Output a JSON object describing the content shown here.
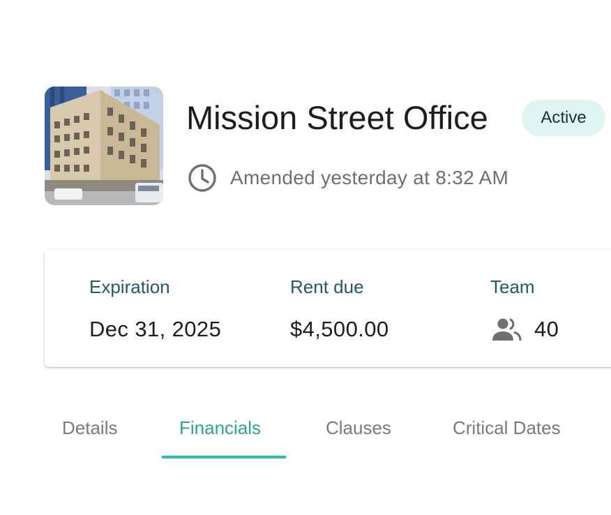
{
  "property": {
    "title": "Mission Street Office",
    "status": "Active",
    "amended": "Amended yesterday at 8:32 AM",
    "image_icon": "building-photo"
  },
  "stats": [
    {
      "label": "Expiration",
      "value": "Dec 31, 2025"
    },
    {
      "label": "Rent due",
      "value": "$4,500.00"
    },
    {
      "label": "Team",
      "value": "40",
      "icon": "people-icon"
    }
  ],
  "tabs": [
    {
      "label": "Details",
      "active": false
    },
    {
      "label": "Financials",
      "active": true
    },
    {
      "label": "Clauses",
      "active": false
    },
    {
      "label": "Critical Dates",
      "active": false
    }
  ],
  "colors": {
    "accent": "#2cbcad",
    "badge_bg": "#dff5f1",
    "stat_label": "#21586a"
  }
}
